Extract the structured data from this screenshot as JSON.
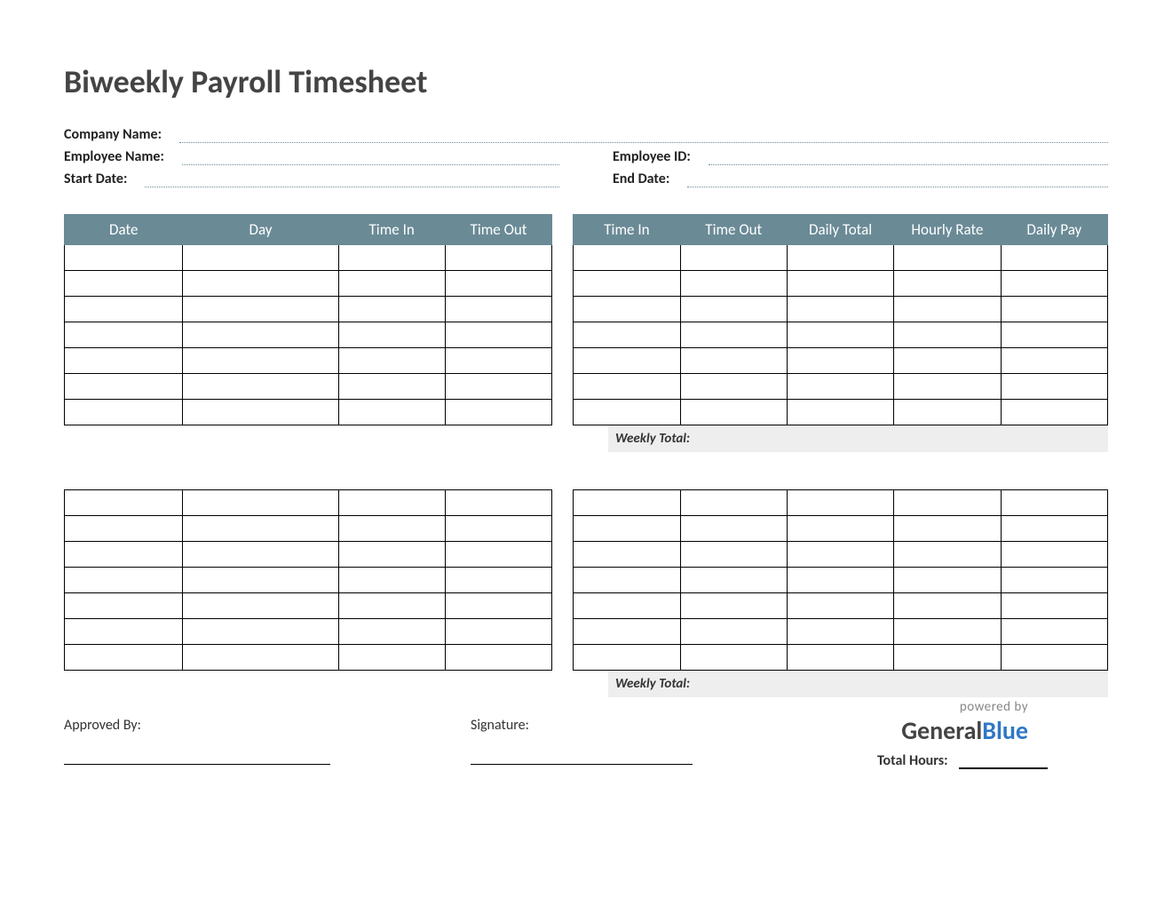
{
  "title": "Biweekly Payroll Timesheet",
  "meta": {
    "company_label": "Company Name:",
    "employee_label": "Employee Name:",
    "employee_id_label": "Employee ID:",
    "start_date_label": "Start Date:",
    "end_date_label": "End Date:"
  },
  "columns": {
    "date": "Date",
    "day": "Day",
    "time_in_1": "Time In",
    "time_out_1": "Time Out",
    "time_in_2": "Time In",
    "time_out_2": "Time Out",
    "daily_total": "Daily Total",
    "hourly_rate": "Hourly Rate",
    "daily_pay": "Daily Pay"
  },
  "weekly_total_label_1": "Weekly Total:",
  "weekly_total_label_2": "Weekly Total:",
  "footer": {
    "approved_by": "Approved By:",
    "signature": "Signature:",
    "total_hours": "Total Hours:"
  },
  "brand": {
    "powered": "powered by",
    "name1": "General",
    "name2": "Blue"
  }
}
